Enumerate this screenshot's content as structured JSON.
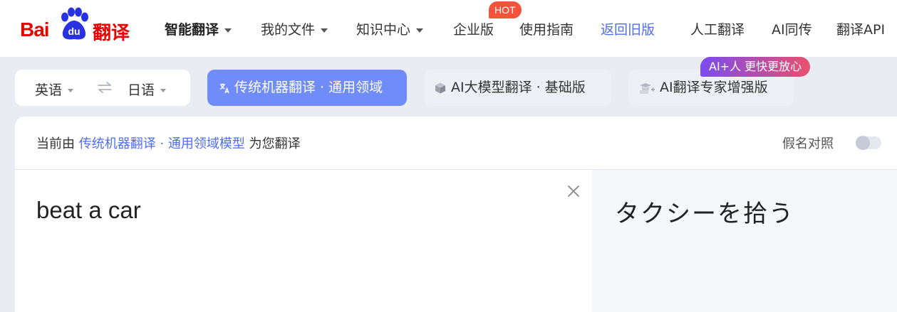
{
  "logo": {
    "text_latin": "Bai",
    "text_du": "du",
    "text_cn": "翻译"
  },
  "nav": {
    "items": [
      {
        "label": "智能翻译",
        "dropdown": true
      },
      {
        "label": "我的文件",
        "dropdown": true
      },
      {
        "label": "知识中心",
        "dropdown": true
      },
      {
        "label": "企业版"
      },
      {
        "label": "使用指南"
      },
      {
        "label": "返回旧版"
      },
      {
        "label": "人工翻译"
      },
      {
        "label": "AI同传"
      },
      {
        "label": "翻译API"
      }
    ],
    "hot_badge": "HOT"
  },
  "language": {
    "source": "英语",
    "target": "日语"
  },
  "modes": [
    {
      "label": "传统机器翻译 · 通用领域",
      "active": true
    },
    {
      "label": "AI大模型翻译 · 基础版"
    },
    {
      "label": "AI翻译专家增强版"
    }
  ],
  "ai_badge": "AI+人 更快更放心",
  "info": {
    "prefix": "当前由",
    "model": "传统机器翻译 · 通用领域模型",
    "suffix": "为您翻译",
    "kana_label": "假名对照"
  },
  "source_text": "beat a car",
  "target_text": "タクシーを拾う",
  "colors": {
    "brand_red": "#e10602",
    "accent_blue": "#4e6ef2",
    "active_mode": "#6f8cf8"
  }
}
